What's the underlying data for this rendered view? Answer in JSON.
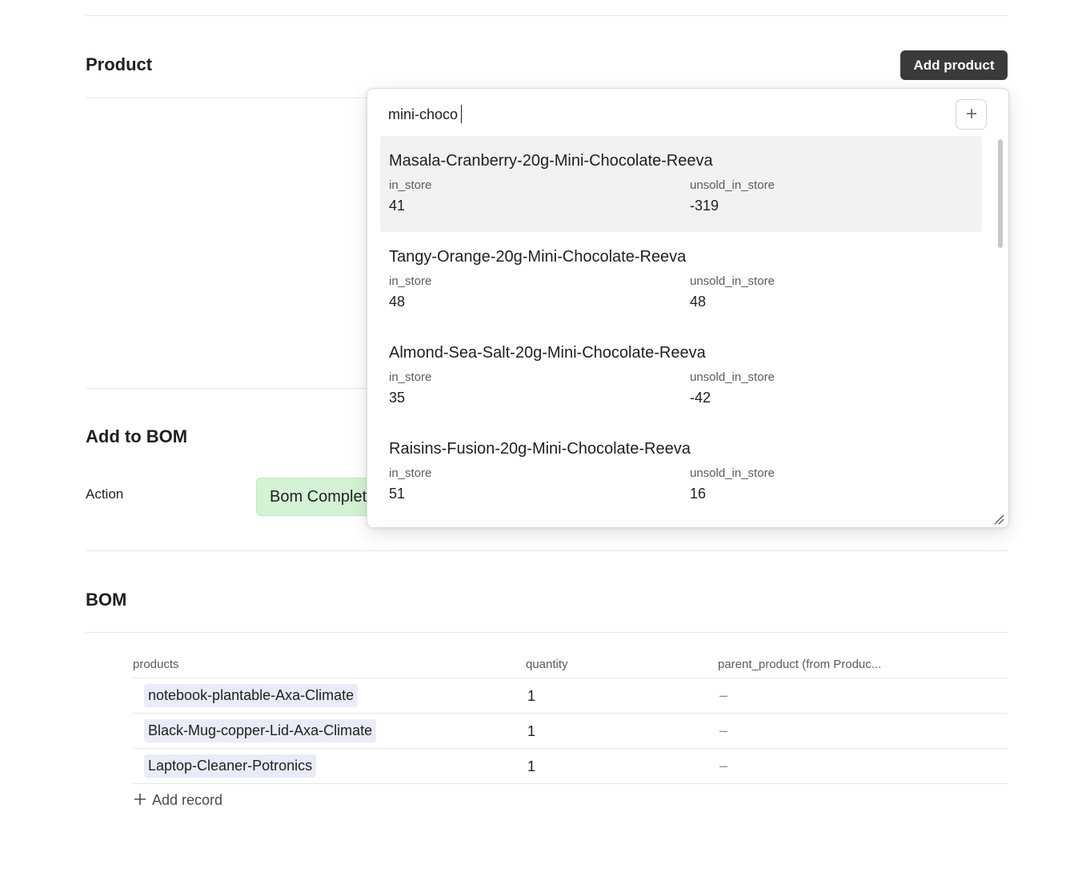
{
  "product_section": {
    "title": "Product",
    "add_button": "Add product"
  },
  "bom_action_section": {
    "title": "Add to BOM",
    "action_label": "Action",
    "action_button": "Bom Complete"
  },
  "bom_section": {
    "title": "BOM",
    "columns": [
      "products",
      "quantity",
      "parent_product (from Produc..."
    ],
    "rows": [
      {
        "product": "notebook-plantable-Axa-Climate",
        "quantity": "1",
        "parent": "–"
      },
      {
        "product": "Black-Mug-copper-Lid-Axa-Climate",
        "quantity": "1",
        "parent": "–"
      },
      {
        "product": "Laptop-Cleaner-Potronics",
        "quantity": "1",
        "parent": "–"
      }
    ],
    "add_record": "Add record"
  },
  "picker": {
    "search_value": "mini-choco",
    "new_button": "+",
    "field_labels": {
      "in_store": "in_store",
      "unsold": "unsold_in_store"
    },
    "results": [
      {
        "name": "Masala-Cranberry-20g-Mini-Chocolate-Reeva",
        "in_store": "41",
        "unsold_in_store": "-319"
      },
      {
        "name": "Tangy-Orange-20g-Mini-Chocolate-Reeva",
        "in_store": "48",
        "unsold_in_store": "48"
      },
      {
        "name": "Almond-Sea-Salt-20g-Mini-Chocolate-Reeva",
        "in_store": "35",
        "unsold_in_store": "-42"
      },
      {
        "name": "Raisins-Fusion-20g-Mini-Chocolate-Reeva",
        "in_store": "51",
        "unsold_in_store": "16"
      }
    ]
  },
  "colors": {
    "primary_button": "#3a3a3a",
    "action_button_bg": "#d4f3d5",
    "chip_bg": "#e9ecf8",
    "active_result_bg": "#f2f2f2"
  }
}
